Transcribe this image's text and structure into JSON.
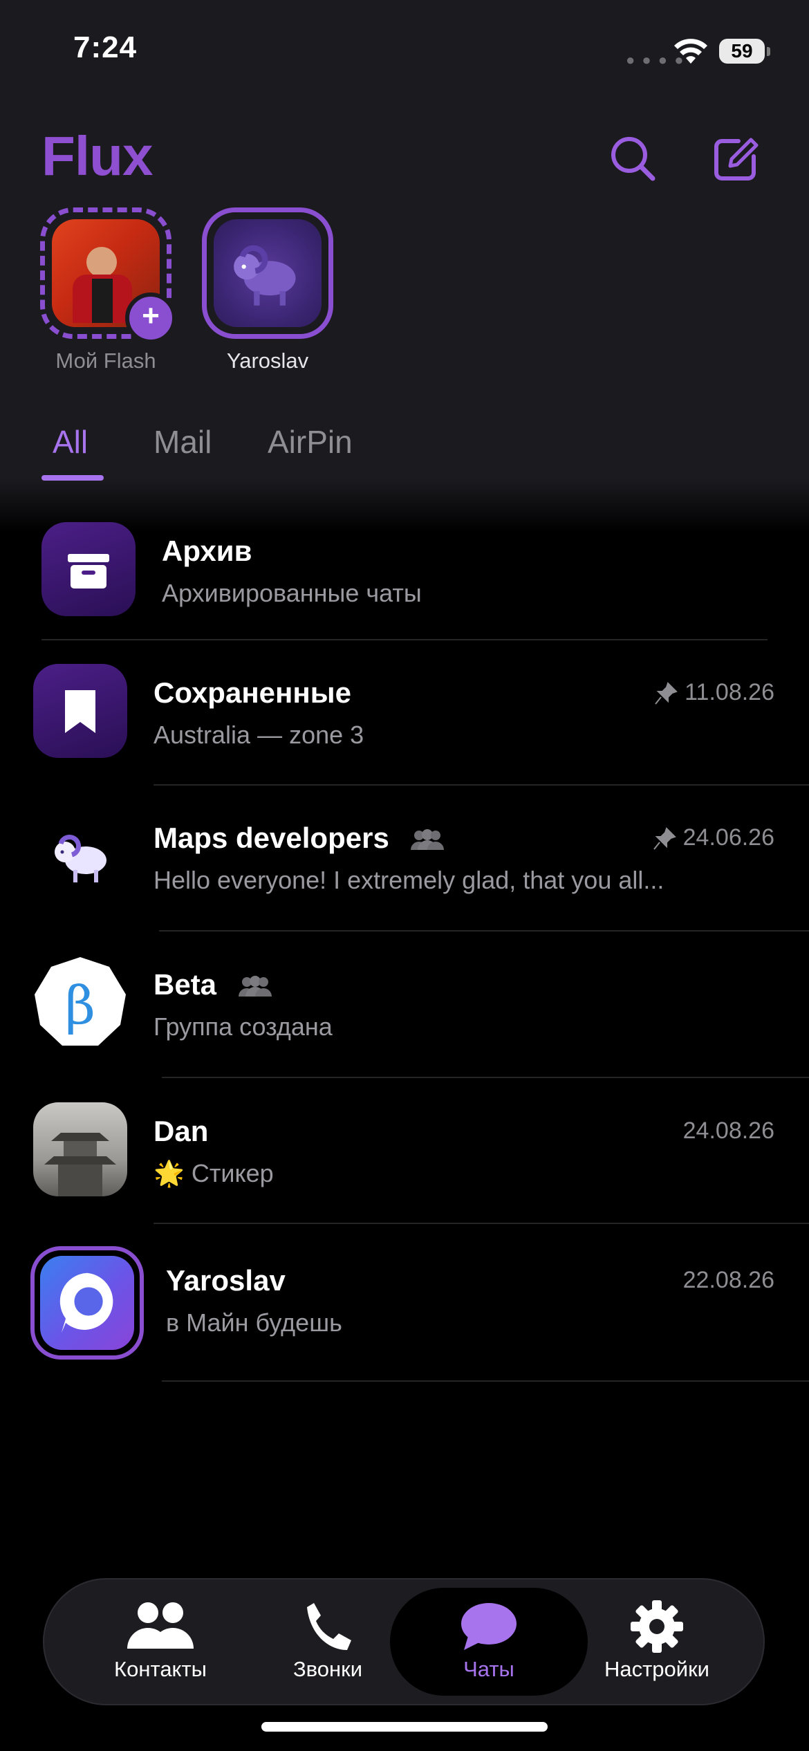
{
  "status": {
    "time": "7:24",
    "battery": "59"
  },
  "app": {
    "logo": "Flux",
    "accent": "#8e4fd1"
  },
  "header": {
    "search_icon": "search-icon",
    "compose_icon": "compose-icon"
  },
  "stories": [
    {
      "label": "Мой Flash"
    },
    {
      "label": "Yaroslav"
    }
  ],
  "tabs": [
    {
      "label": "All"
    },
    {
      "label": "Mail"
    },
    {
      "label": "AirPin"
    }
  ],
  "chats": [
    {
      "title": "Архив",
      "subtitle": "Архивированные чаты"
    },
    {
      "title": "Сохраненные",
      "subtitle": "Australia — zone 3",
      "date": "11.08.26",
      "pinned": true
    },
    {
      "title": "Maps developers",
      "subtitle": "Hello everyone! I extremely glad, that you all...",
      "date": "24.06.26",
      "pinned": true,
      "group": true
    },
    {
      "title": "Beta",
      "subtitle": "Группа создана",
      "group": true,
      "avatar_letter": "β"
    },
    {
      "title": "Dan",
      "subtitle_emoji": "🌟",
      "subtitle": "Стикер",
      "date": "24.08.26"
    },
    {
      "title": "Yaroslav",
      "subtitle": "в Майн будешь",
      "date": "22.08.26"
    }
  ],
  "nav": [
    {
      "label": "Контакты"
    },
    {
      "label": "Звонки"
    },
    {
      "label": "Чаты"
    },
    {
      "label": "Настройки"
    }
  ]
}
